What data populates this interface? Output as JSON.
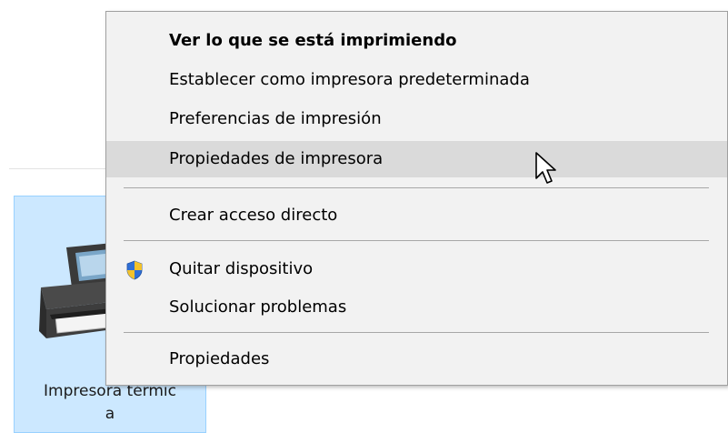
{
  "device": {
    "label_line1": "Impresora térmic",
    "label_line2": "a"
  },
  "context_menu": {
    "items": [
      {
        "label": "Ver lo que se está imprimiendo"
      },
      {
        "label": "Establecer como impresora predeterminada"
      },
      {
        "label": "Preferencias de impresión"
      },
      {
        "label": "Propiedades de impresora"
      },
      {
        "label": "Crear acceso directo"
      },
      {
        "label": "Quitar dispositivo"
      },
      {
        "label": "Solucionar problemas"
      },
      {
        "label": "Propiedades"
      }
    ]
  },
  "icons": {
    "printer": "printer-icon",
    "shield": "uac-shield-icon",
    "cursor": "mouse-pointer-icon"
  },
  "colors": {
    "menu_background": "#f2f2f2",
    "menu_highlight": "#dadada",
    "tile_selection": "#cce8ff",
    "tile_border": "#99d1ff"
  }
}
